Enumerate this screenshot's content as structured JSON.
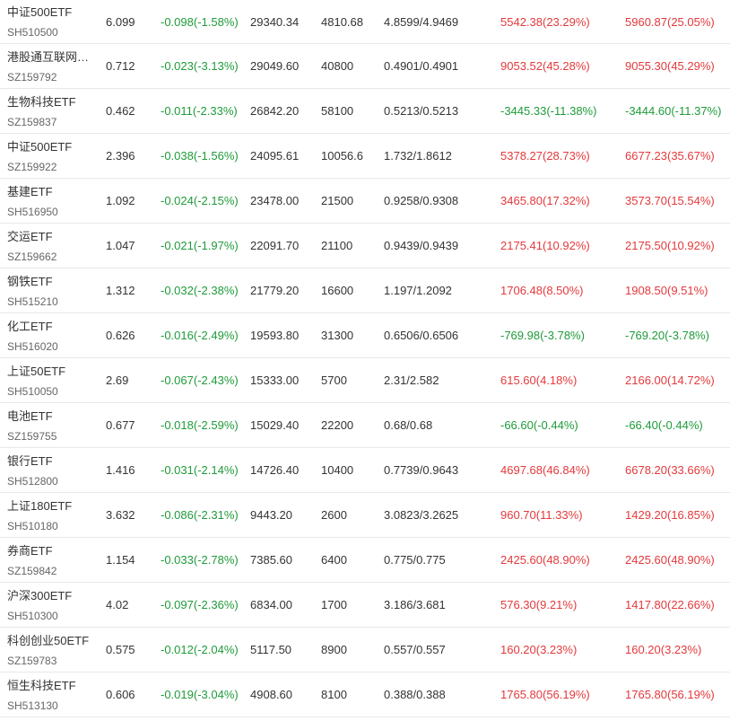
{
  "colors": {
    "positive": "#e4393c",
    "negative": "#1f9b3a",
    "text": "#333333",
    "subtext": "#666666",
    "divider": "#e8e8e8"
  },
  "rows": [
    {
      "name": "中证500ETF",
      "code": "SH510500",
      "price": "6.099",
      "change": "-0.098(-1.58%)",
      "amount": "29340.34",
      "shares": "4810.68",
      "nav": "4.8599/4.9469",
      "pnl1": "5542.38(23.29%)",
      "pnl1_dir": "up",
      "pnl2": "5960.87(25.05%)",
      "pnl2_dir": "up"
    },
    {
      "name": "港股通互联网…",
      "code": "SZ159792",
      "price": "0.712",
      "change": "-0.023(-3.13%)",
      "amount": "29049.60",
      "shares": "40800",
      "nav": "0.4901/0.4901",
      "pnl1": "9053.52(45.28%)",
      "pnl1_dir": "up",
      "pnl2": "9055.30(45.29%)",
      "pnl2_dir": "up"
    },
    {
      "name": "生物科技ETF",
      "code": "SZ159837",
      "price": "0.462",
      "change": "-0.011(-2.33%)",
      "amount": "26842.20",
      "shares": "58100",
      "nav": "0.5213/0.5213",
      "pnl1": "-3445.33(-11.38%)",
      "pnl1_dir": "down",
      "pnl2": "-3444.60(-11.37%)",
      "pnl2_dir": "down"
    },
    {
      "name": "中证500ETF",
      "code": "SZ159922",
      "price": "2.396",
      "change": "-0.038(-1.56%)",
      "amount": "24095.61",
      "shares": "10056.6",
      "nav": "1.732/1.8612",
      "pnl1": "5378.27(28.73%)",
      "pnl1_dir": "up",
      "pnl2": "6677.23(35.67%)",
      "pnl2_dir": "up"
    },
    {
      "name": "基建ETF",
      "code": "SH516950",
      "price": "1.092",
      "change": "-0.024(-2.15%)",
      "amount": "23478.00",
      "shares": "21500",
      "nav": "0.9258/0.9308",
      "pnl1": "3465.80(17.32%)",
      "pnl1_dir": "up",
      "pnl2": "3573.70(15.54%)",
      "pnl2_dir": "up"
    },
    {
      "name": "交运ETF",
      "code": "SZ159662",
      "price": "1.047",
      "change": "-0.021(-1.97%)",
      "amount": "22091.70",
      "shares": "21100",
      "nav": "0.9439/0.9439",
      "pnl1": "2175.41(10.92%)",
      "pnl1_dir": "up",
      "pnl2": "2175.50(10.92%)",
      "pnl2_dir": "up"
    },
    {
      "name": "钢铁ETF",
      "code": "SH515210",
      "price": "1.312",
      "change": "-0.032(-2.38%)",
      "amount": "21779.20",
      "shares": "16600",
      "nav": "1.197/1.2092",
      "pnl1": "1706.48(8.50%)",
      "pnl1_dir": "up",
      "pnl2": "1908.50(9.51%)",
      "pnl2_dir": "up"
    },
    {
      "name": "化工ETF",
      "code": "SH516020",
      "price": "0.626",
      "change": "-0.016(-2.49%)",
      "amount": "19593.80",
      "shares": "31300",
      "nav": "0.6506/0.6506",
      "pnl1": "-769.98(-3.78%)",
      "pnl1_dir": "down",
      "pnl2": "-769.20(-3.78%)",
      "pnl2_dir": "down"
    },
    {
      "name": "上证50ETF",
      "code": "SH510050",
      "price": "2.69",
      "change": "-0.067(-2.43%)",
      "amount": "15333.00",
      "shares": "5700",
      "nav": "2.31/2.582",
      "pnl1": "615.60(4.18%)",
      "pnl1_dir": "up",
      "pnl2": "2166.00(14.72%)",
      "pnl2_dir": "up"
    },
    {
      "name": "电池ETF",
      "code": "SZ159755",
      "price": "0.677",
      "change": "-0.018(-2.59%)",
      "amount": "15029.40",
      "shares": "22200",
      "nav": "0.68/0.68",
      "pnl1": "-66.60(-0.44%)",
      "pnl1_dir": "down",
      "pnl2": "-66.40(-0.44%)",
      "pnl2_dir": "down"
    },
    {
      "name": "银行ETF",
      "code": "SH512800",
      "price": "1.416",
      "change": "-0.031(-2.14%)",
      "amount": "14726.40",
      "shares": "10400",
      "nav": "0.7739/0.9643",
      "pnl1": "4697.68(46.84%)",
      "pnl1_dir": "up",
      "pnl2": "6678.20(33.66%)",
      "pnl2_dir": "up"
    },
    {
      "name": "上证180ETF",
      "code": "SH510180",
      "price": "3.632",
      "change": "-0.086(-2.31%)",
      "amount": "9443.20",
      "shares": "2600",
      "nav": "3.0823/3.2625",
      "pnl1": "960.70(11.33%)",
      "pnl1_dir": "up",
      "pnl2": "1429.20(16.85%)",
      "pnl2_dir": "up"
    },
    {
      "name": "券商ETF",
      "code": "SZ159842",
      "price": "1.154",
      "change": "-0.033(-2.78%)",
      "amount": "7385.60",
      "shares": "6400",
      "nav": "0.775/0.775",
      "pnl1": "2425.60(48.90%)",
      "pnl1_dir": "up",
      "pnl2": "2425.60(48.90%)",
      "pnl2_dir": "up"
    },
    {
      "name": "沪深300ETF",
      "code": "SH510300",
      "price": "4.02",
      "change": "-0.097(-2.36%)",
      "amount": "6834.00",
      "shares": "1700",
      "nav": "3.186/3.681",
      "pnl1": "576.30(9.21%)",
      "pnl1_dir": "up",
      "pnl2": "1417.80(22.66%)",
      "pnl2_dir": "up"
    },
    {
      "name": "科创创业50ETF",
      "code": "SZ159783",
      "price": "0.575",
      "change": "-0.012(-2.04%)",
      "amount": "5117.50",
      "shares": "8900",
      "nav": "0.557/0.557",
      "pnl1": "160.20(3.23%)",
      "pnl1_dir": "up",
      "pnl2": "160.20(3.23%)",
      "pnl2_dir": "up"
    },
    {
      "name": "恒生科技ETF",
      "code": "SH513130",
      "price": "0.606",
      "change": "-0.019(-3.04%)",
      "amount": "4908.60",
      "shares": "8100",
      "nav": "0.388/0.388",
      "pnl1": "1765.80(56.19%)",
      "pnl1_dir": "up",
      "pnl2": "1765.80(56.19%)",
      "pnl2_dir": "up"
    }
  ]
}
